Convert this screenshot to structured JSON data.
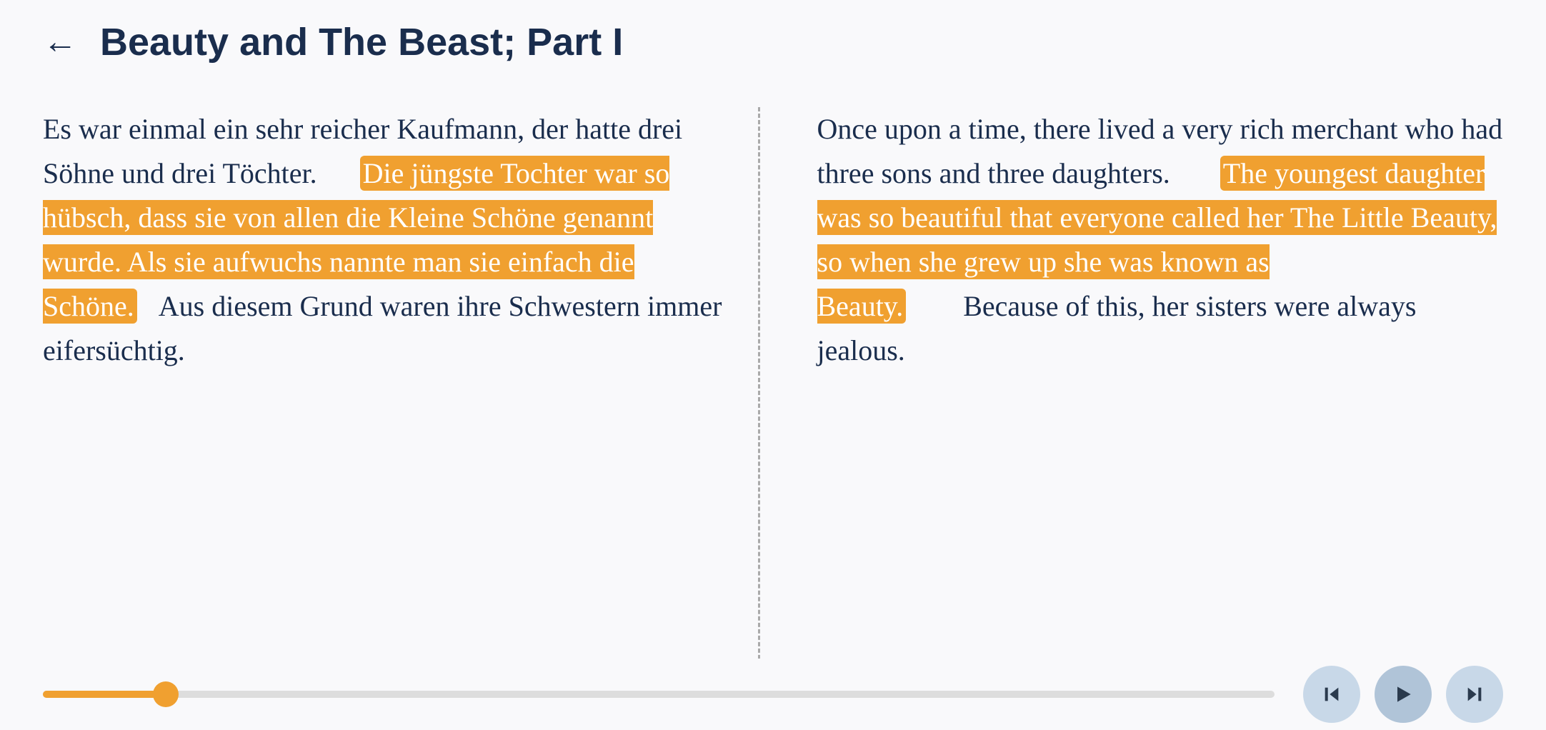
{
  "header": {
    "back_label": "←",
    "title": "Beauty and The Beast; Part I"
  },
  "left_column": {
    "text_segments": [
      {
        "text": "Es war einmal ein sehr reicher Kaufmann, der hatte drei Söhne und drei Töchter.      ",
        "highlighted": false
      },
      {
        "text": "Die jüngste Tochter war so hübsch, dass sie von allen die Kleine Schöne genannt wurde. Als sie aufwuchs nannte man sie einfach die Schöne.",
        "highlighted": true
      },
      {
        "text": "   Aus diesem Grund waren ihre Schwestern immer eifersüchtig.",
        "highlighted": false
      }
    ]
  },
  "right_column": {
    "text_segments": [
      {
        "text": "Once upon a time, there lived a very rich merchant who had three sons and three daughters.       ",
        "highlighted": false
      },
      {
        "text": "The youngest daughter was so beautiful that everyone called her The Little Beauty, so when she grew up she was known as Beauty.",
        "highlighted": true
      },
      {
        "text": "         Because of this, her sisters were always jealous.",
        "highlighted": false
      }
    ]
  },
  "player": {
    "progress_percent": 10,
    "btn_rewind": "⏮",
    "btn_play": "▶",
    "btn_forward": "⏭"
  },
  "icons": {
    "back_arrow": "←",
    "rewind": "◀|",
    "play": "▶",
    "forward": "|▶"
  }
}
